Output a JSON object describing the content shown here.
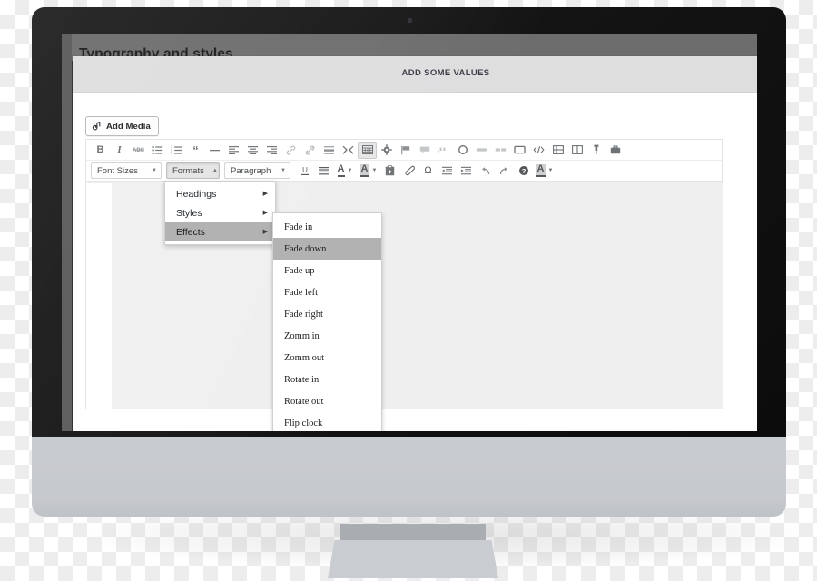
{
  "device": {
    "type": "imac-monitor-mockup",
    "camera": "camera-dot"
  },
  "page": {
    "title": "Typography and styles",
    "panel_header_label": "ADD SOME VALUES"
  },
  "editor": {
    "add_media_label": "Add Media",
    "toolbar_row1": [
      {
        "name": "bold",
        "glyph": "B"
      },
      {
        "name": "italic",
        "glyph": "I"
      },
      {
        "name": "strikethrough",
        "glyph": "ABC"
      },
      {
        "name": "bulleted-list",
        "glyph": "ul"
      },
      {
        "name": "numbered-list",
        "glyph": "ol"
      },
      {
        "name": "blockquote",
        "glyph": "“"
      },
      {
        "name": "horizontal-rule",
        "glyph": "—"
      },
      {
        "name": "align-left",
        "glyph": "al"
      },
      {
        "name": "align-center",
        "glyph": "ac"
      },
      {
        "name": "align-right",
        "glyph": "ar"
      },
      {
        "name": "insert-link",
        "glyph": "link"
      },
      {
        "name": "remove-link",
        "glyph": "unlink"
      },
      {
        "name": "insert-read-more",
        "glyph": "more"
      },
      {
        "name": "distraction-free",
        "glyph": "dfw"
      },
      {
        "name": "toolbar-toggle",
        "glyph": "kitchen-sink",
        "active": true
      },
      {
        "name": "settings-gear",
        "glyph": "gear"
      },
      {
        "name": "flag",
        "glyph": "flag"
      },
      {
        "name": "comment-box",
        "glyph": "box"
      },
      {
        "name": "quote-block",
        "glyph": "quote"
      },
      {
        "name": "circle",
        "glyph": "circle"
      },
      {
        "name": "button-wide",
        "glyph": "pill"
      },
      {
        "name": "columns-two",
        "glyph": "cols"
      },
      {
        "name": "frame",
        "glyph": "frame"
      },
      {
        "name": "source-code",
        "glyph": "code"
      },
      {
        "name": "grid-layout",
        "glyph": "grid"
      },
      {
        "name": "split-layout",
        "glyph": "split"
      },
      {
        "name": "pin",
        "glyph": "pin"
      },
      {
        "name": "briefcase",
        "glyph": "briefcase"
      }
    ],
    "toolbar_row2": {
      "font_sizes_label": "Font Sizes",
      "formats_label": "Formats",
      "paragraph_label": "Paragraph",
      "buttons": [
        {
          "name": "underline",
          "glyph": "U"
        },
        {
          "name": "justify",
          "glyph": "justify"
        },
        {
          "name": "text-color",
          "glyph": "A"
        },
        {
          "name": "background-color",
          "glyph": "A-box"
        },
        {
          "name": "paste-as-text",
          "glyph": "clipboard"
        },
        {
          "name": "clear-formatting",
          "glyph": "eraser"
        },
        {
          "name": "special-character",
          "glyph": "Ω"
        },
        {
          "name": "outdent",
          "glyph": "outdent"
        },
        {
          "name": "indent",
          "glyph": "indent"
        },
        {
          "name": "undo",
          "glyph": "undo"
        },
        {
          "name": "redo",
          "glyph": "redo"
        },
        {
          "name": "keyboard-shortcuts",
          "glyph": "help"
        },
        {
          "name": "extra-color",
          "glyph": "A-box2"
        }
      ]
    }
  },
  "formats_menu": {
    "items": [
      {
        "label": "Headings",
        "has_submenu": true,
        "selected": false
      },
      {
        "label": "Styles",
        "has_submenu": true,
        "selected": false
      },
      {
        "label": "Effects",
        "has_submenu": true,
        "selected": true
      }
    ]
  },
  "effects_menu": {
    "items": [
      {
        "label": "Fade in",
        "selected": false
      },
      {
        "label": "Fade down",
        "selected": true
      },
      {
        "label": "Fade up",
        "selected": false
      },
      {
        "label": "Fade left",
        "selected": false
      },
      {
        "label": "Fade right",
        "selected": false
      },
      {
        "label": "Zomm in",
        "selected": false
      },
      {
        "label": "Zomm out",
        "selected": false
      },
      {
        "label": "Rotate in",
        "selected": false
      },
      {
        "label": "Rotate out",
        "selected": false
      },
      {
        "label": "Flip clock",
        "selected": false
      }
    ]
  },
  "colors": {
    "screen_backdrop": "#6d6d6d",
    "panel_header": "#dededf",
    "editor_canvas": "#efefef",
    "menu_highlight": "#b2b2b2",
    "bezel": "#141414",
    "chin": "#c9ccd1"
  }
}
